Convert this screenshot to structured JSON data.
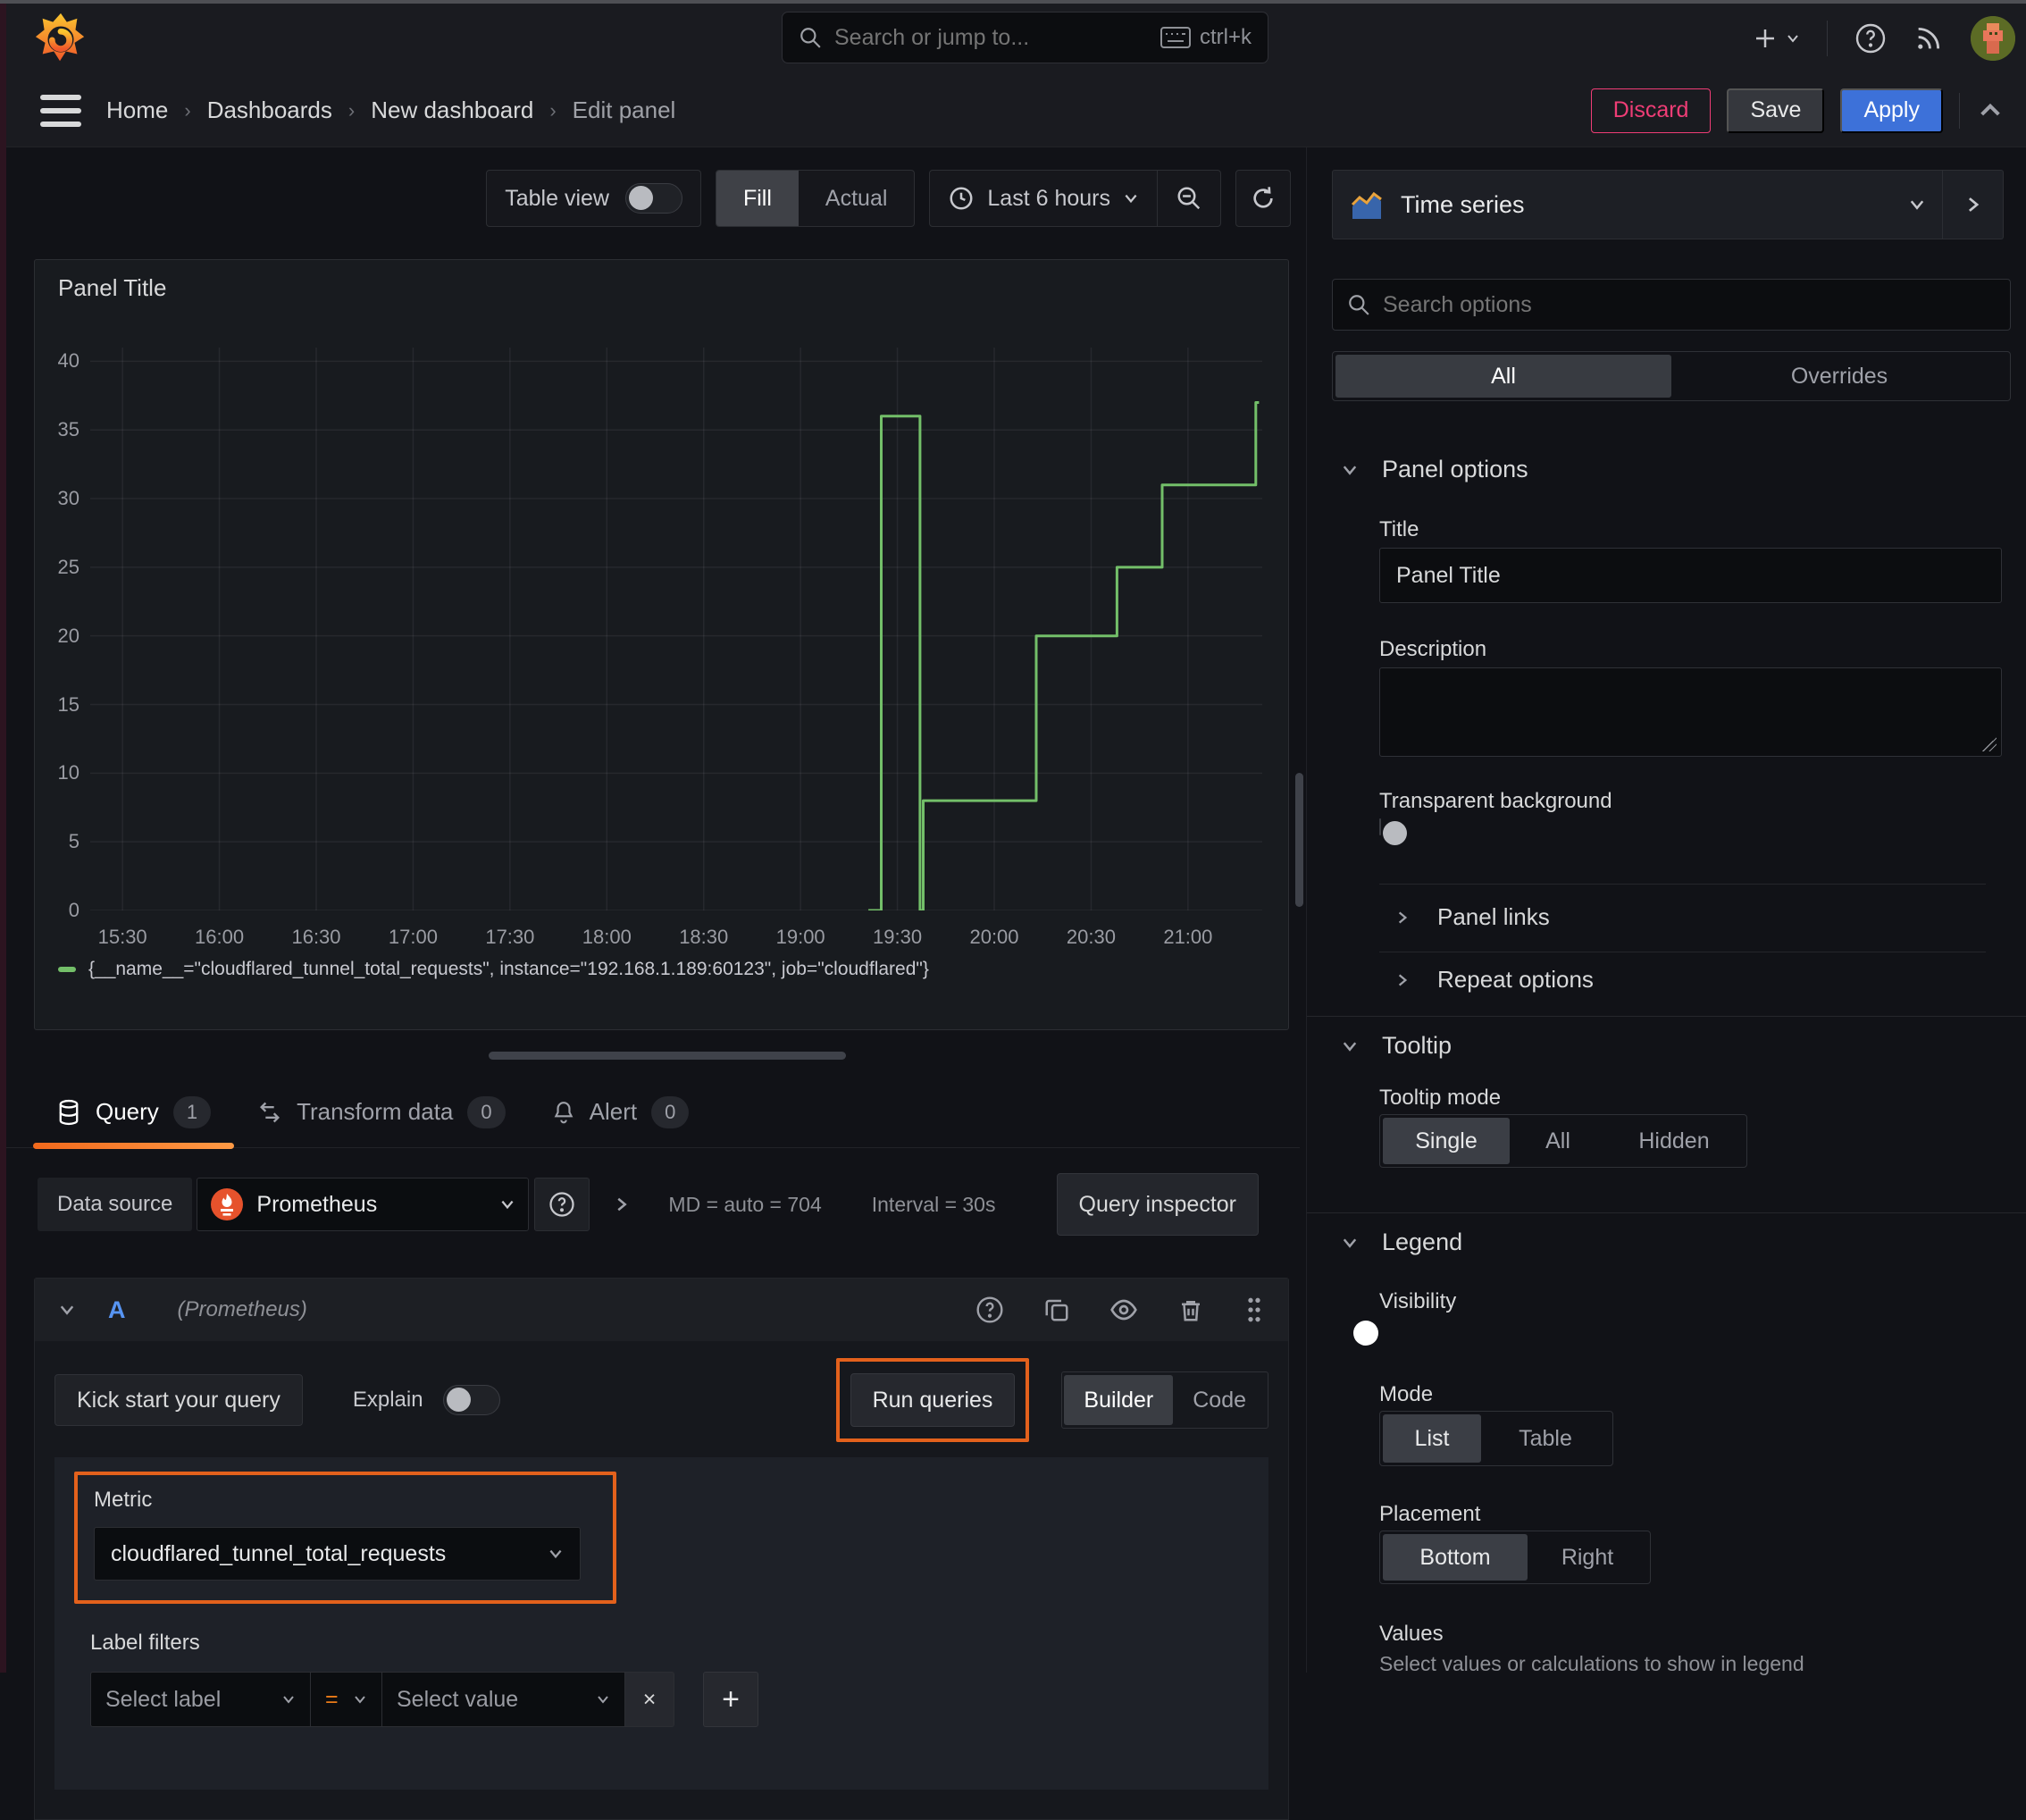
{
  "topbar": {
    "search_placeholder": "Search or jump to...",
    "shortcut": "ctrl+k"
  },
  "breadcrumb": {
    "items": [
      {
        "label": "Home"
      },
      {
        "label": "Dashboards"
      },
      {
        "label": "New dashboard"
      },
      {
        "label": "Edit panel"
      }
    ]
  },
  "actions": {
    "discard": "Discard",
    "save": "Save",
    "apply": "Apply"
  },
  "toolbar": {
    "table_view": "Table view",
    "fill": "Fill",
    "actual": "Actual",
    "time_range": "Last 6 hours"
  },
  "viz_picker": {
    "label": "Time series"
  },
  "panel": {
    "title": "Panel Title"
  },
  "chart_data": {
    "type": "line",
    "step": true,
    "title": "Panel Title",
    "xlabel": "",
    "ylabel": "",
    "x_range": [
      "15:20",
      "21:23"
    ],
    "ylim": [
      0,
      41
    ],
    "grid": true,
    "legend_position": "bottom",
    "y_ticks": [
      0,
      5,
      10,
      15,
      20,
      25,
      30,
      35,
      40
    ],
    "x_ticks": [
      "15:30",
      "16:00",
      "16:30",
      "17:00",
      "17:30",
      "18:00",
      "18:30",
      "19:00",
      "19:30",
      "20:00",
      "20:30",
      "21:00"
    ],
    "series": [
      {
        "name": "{__name__=\"cloudflared_tunnel_total_requests\", instance=\"192.168.1.189:60123\", job=\"cloudflared\"}",
        "color": "#73bf69",
        "points": [
          [
            "19:21",
            0
          ],
          [
            "19:25",
            0
          ],
          [
            "19:25",
            36
          ],
          [
            "19:37",
            36
          ],
          [
            "19:37",
            0
          ],
          [
            "19:38",
            0
          ],
          [
            "19:38",
            8
          ],
          [
            "20:13",
            8
          ],
          [
            "20:13",
            20
          ],
          [
            "20:38",
            20
          ],
          [
            "20:38",
            25
          ],
          [
            "20:52",
            25
          ],
          [
            "20:52",
            31
          ],
          [
            "21:21",
            31
          ],
          [
            "21:21",
            37
          ],
          [
            "21:22",
            37
          ]
        ]
      }
    ]
  },
  "query_tabs": {
    "query": "Query",
    "query_count": "1",
    "transform": "Transform data",
    "transform_count": "0",
    "alert": "Alert",
    "alert_count": "0"
  },
  "query_editor": {
    "datasource_label": "Data source",
    "datasource": "Prometheus",
    "stats_md": "MD = auto = 704",
    "stats_interval": "Interval = 30s",
    "inspector": "Query inspector",
    "ref": "A",
    "ref_ds": "(Prometheus)",
    "kickstart": "Kick start your query",
    "explain": "Explain",
    "run_queries": "Run queries",
    "builder": "Builder",
    "code": "Code",
    "metric_label": "Metric",
    "metric_value": "cloudflared_tunnel_total_requests",
    "label_filters": "Label filters",
    "select_label": "Select label",
    "eq": "=",
    "select_value": "Select value",
    "remove": "×",
    "add": "+"
  },
  "options": {
    "search_placeholder": "Search options",
    "tab_all": "All",
    "tab_overrides": "Overrides",
    "panel_options": "Panel options",
    "title_label": "Title",
    "title_value": "Panel Title",
    "description_label": "Description",
    "transparent": "Transparent background",
    "panel_links": "Panel links",
    "repeat_options": "Repeat options",
    "tooltip": "Tooltip",
    "tooltip_mode": "Tooltip mode",
    "tooltip_single": "Single",
    "tooltip_all": "All",
    "tooltip_hidden": "Hidden",
    "legend": "Legend",
    "visibility": "Visibility",
    "mode": "Mode",
    "mode_list": "List",
    "mode_table": "Table",
    "placement": "Placement",
    "placement_bottom": "Bottom",
    "placement_right": "Right",
    "values": "Values",
    "values_help": "Select values or calculations to show in legend"
  },
  "colors": {
    "accent_orange": "#e3611c",
    "series_green": "#73bf69",
    "accent_blue": "#3d71d9",
    "danger_pink": "#ef3d76"
  }
}
